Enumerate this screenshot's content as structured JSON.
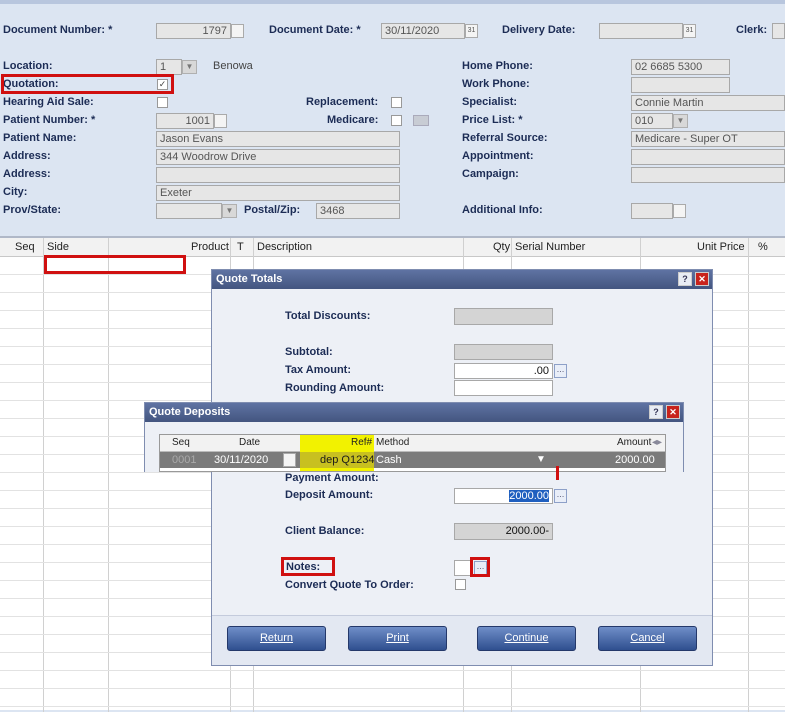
{
  "header": {
    "document_number_label": "Document Number: *",
    "document_number": "1797",
    "document_date_label": "Document Date: *",
    "document_date": "30/11/2020",
    "delivery_date_label": "Delivery Date:",
    "clerk_label": "Clerk:",
    "calendar_glyph": "31"
  },
  "left_form": {
    "location_label": "Location:",
    "location_value": "1",
    "location_name": "Benowa",
    "quotation_label": "Quotation:",
    "hearing_aid_label": "Hearing Aid Sale:",
    "replacement_label": "Replacement:",
    "patient_number_label": "Patient Number: *",
    "patient_number": "1001",
    "medicare_label": "Medicare:",
    "patient_name_label": "Patient Name:",
    "patient_name": "Jason Evans",
    "address1_label": "Address:",
    "address1": "344 Woodrow Drive",
    "address2_label": "Address:",
    "address2": "",
    "city_label": "City:",
    "city": "Exeter",
    "prov_label": "Prov/State:",
    "postal_label": "Postal/Zip:",
    "postal": "3468"
  },
  "right_form": {
    "home_phone_label": "Home Phone:",
    "home_phone": "02 6685 5300",
    "work_phone_label": "Work Phone:",
    "specialist_label": "Specialist:",
    "specialist": "Connie Martin",
    "price_list_label": "Price List: *",
    "price_list": "010",
    "referral_label": "Referral Source:",
    "referral": "Medicare - Super OT",
    "appointment_label": "Appointment:",
    "campaign_label": "Campaign:",
    "additional_label": "Additional Info:"
  },
  "grid": {
    "columns": [
      "Seq",
      "Side",
      "Product",
      "T",
      "Description",
      "Qty",
      "Serial Number",
      "Unit Price",
      "%"
    ]
  },
  "quote_totals": {
    "title": "Quote Totals",
    "total_discounts_label": "Total Discounts:",
    "subtotal_label": "Subtotal:",
    "tax_label": "Tax Amount:",
    "tax_value": ".00",
    "rounding_label": "Rounding Amount:",
    "payment_label": "Payment Amount:",
    "deposit_label": "Deposit Amount:",
    "deposit_value": "2000.00",
    "balance_label": "Client Balance:",
    "balance_value": "2000.00-",
    "notes_label": "Notes:",
    "convert_label": "Convert Quote To Order:",
    "buttons": [
      "Return",
      "Print",
      "Continue",
      "Cancel"
    ]
  },
  "quote_deposits": {
    "title": "Quote Deposits",
    "columns": [
      "Seq",
      "Date",
      "Ref#",
      "Method",
      "Amount"
    ],
    "row": {
      "seq": "0001",
      "date": "30/11/2020",
      "ref": "dep Q1234",
      "method": "Cash",
      "amount": "2000.00"
    }
  },
  "colors": {
    "accent_red": "#d01010",
    "highlight_yellow": "#f2f200",
    "title_bar": "#4a5c88"
  }
}
